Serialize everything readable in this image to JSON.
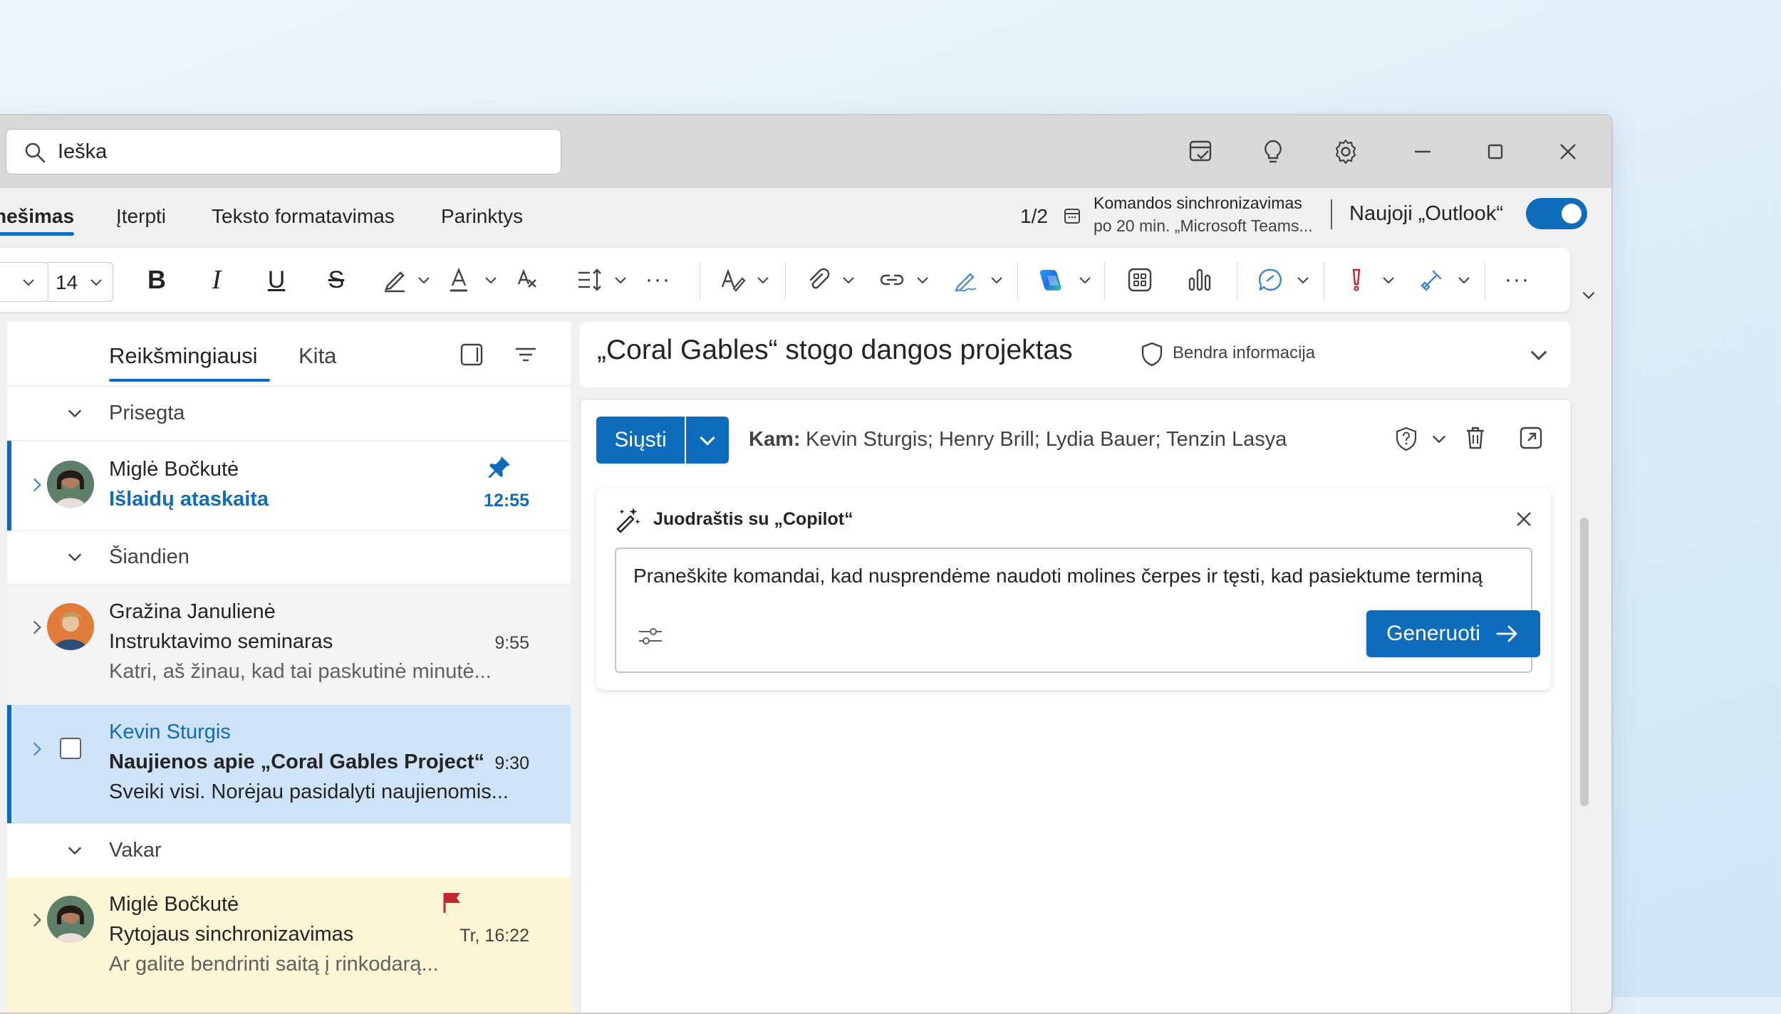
{
  "search": {
    "placeholder": "Ieška"
  },
  "tabs": [
    {
      "label": "nešimas",
      "active": true
    },
    {
      "label": "Įterpti"
    },
    {
      "label": "Teksto formatavimas"
    },
    {
      "label": "Parinktys"
    }
  ],
  "sync": {
    "counter": "1/2",
    "title": "Komandos sinchronizavimas",
    "detail": "po 20 min. „Microsoft Teams..."
  },
  "new_outlook": {
    "label": "Naujoji „Outlook“",
    "enabled": true
  },
  "ribbon": {
    "font_size": "14"
  },
  "list": {
    "tab_focused": "Reikšmingiausi",
    "tab_other": "Kita",
    "sections": {
      "pinned": "Prisegta",
      "today": "Šiandien",
      "yesterday": "Vakar"
    },
    "items": [
      {
        "sender": "Miglė Bočkutė",
        "subject": "Išlaidų ataskaita",
        "time": "12:55"
      },
      {
        "sender": "Gražina Janulienė",
        "subject": "Instruktavimo seminaras",
        "time": "9:55",
        "preview": "Katri, aš žinau, kad tai paskutinė minutė..."
      },
      {
        "sender": "Kevin Sturgis",
        "subject": "Naujienos apie „Coral Gables Project“",
        "time": "9:30",
        "preview": "Sveiki visi. Norėjau pasidalyti naujienomis..."
      },
      {
        "sender": "Miglė Bočkutė",
        "subject": "Rytojaus sinchronizavimas",
        "time": "Tr, 16:22",
        "preview": "Ar galite bendrinti saitą į rinkodarą..."
      }
    ]
  },
  "reading": {
    "subject": "„Coral Gables“ stogo dangos projektas",
    "sensitivity": "Bendra informacija"
  },
  "compose": {
    "send_label": "Siųsti",
    "to_label": "Kam:",
    "recipients": "Kevin Sturgis; Henry Brill; Lydia Bauer; Tenzin Lasya"
  },
  "copilot": {
    "title": "Juodraštis su „Copilot“",
    "prompt": "Praneškite komandai, kad nusprendėme naudoti molines čerpes ir tęsti, kad pasiektume terminą",
    "generate_label": "Generuoti"
  },
  "colors": {
    "accent": "#0f6cbd",
    "selected_row": "#cfe3f8",
    "flagged_row": "#fdf6d4",
    "flag": "#c4262e"
  }
}
